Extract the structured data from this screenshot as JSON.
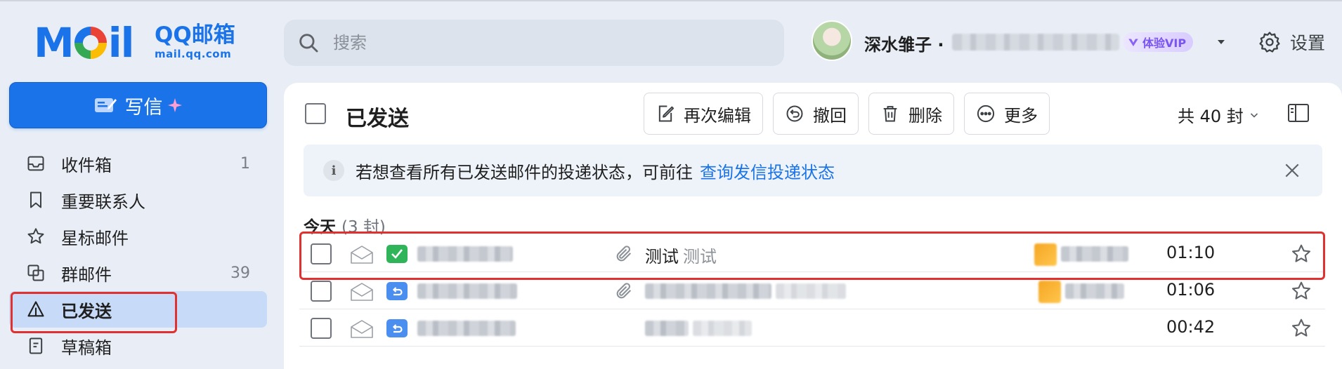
{
  "brand": {
    "logo_word_left": "M",
    "logo_word_right": "il",
    "title": "QQ邮箱",
    "domain": "mail.qq.com"
  },
  "search": {
    "placeholder": "搜索"
  },
  "user": {
    "name": "深水雏子 ·",
    "vip_label": "体验VIP"
  },
  "settings_label": "设置",
  "compose_label": "写信",
  "sidebar": {
    "items": [
      {
        "label": "收件箱",
        "count": "1",
        "icon": "inbox-icon"
      },
      {
        "label": "重要联系人",
        "count": "",
        "icon": "bookmark-icon"
      },
      {
        "label": "星标邮件",
        "count": "",
        "icon": "star-icon"
      },
      {
        "label": "群邮件",
        "count": "39",
        "icon": "group-icon"
      },
      {
        "label": "已发送",
        "count": "",
        "icon": "sent-icon",
        "active": true
      },
      {
        "label": "草稿箱",
        "count": "",
        "icon": "draft-icon"
      }
    ]
  },
  "main": {
    "title": "已发送",
    "toolbar": {
      "reedit": "再次编辑",
      "recall": "撤回",
      "delete": "删除",
      "more": "更多"
    },
    "total": "共 40 封",
    "notice": {
      "text": "若想查看所有已发送邮件的投递状态，可前往",
      "link": "查询发信投递状态"
    },
    "group": {
      "label": "今天",
      "count": "(3 封)"
    },
    "rows": [
      {
        "status": "delivered",
        "subject": "测试",
        "preview": "测试",
        "has_attachment": true,
        "time": "01:10"
      },
      {
        "status": "recalled",
        "subject": "",
        "preview": "",
        "has_attachment": true,
        "time": "01:06"
      },
      {
        "status": "recalled",
        "subject": "",
        "preview": "",
        "has_attachment": false,
        "time": "00:42"
      }
    ]
  },
  "colors": {
    "accent": "#1a73e8",
    "sidebar_bg": "#e9eef6",
    "active_item": "#c7daf7",
    "highlight": "#e03030",
    "delivered": "#2fb45a",
    "recalled": "#4a8ef0"
  }
}
